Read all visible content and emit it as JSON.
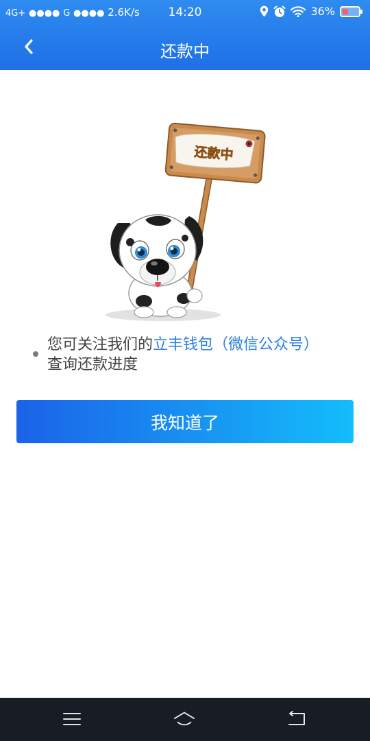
{
  "status_bar": {
    "network_1": "4G+",
    "signal_1": "●●●●",
    "network_2": "G",
    "signal_2": "●●●●",
    "speed": "2.6K/s",
    "time": "14:20",
    "battery": "36%",
    "battery_level": 0.36,
    "icons": [
      "location-icon",
      "alarm-icon",
      "wifi-icon",
      "battery-icon"
    ]
  },
  "header": {
    "title": "还款中",
    "back_icon": "chevron-left-icon"
  },
  "illustration": {
    "sign_text": "还款中",
    "description_icon": "dalmatian-mascot"
  },
  "tip": {
    "text_before": "您可关注我们的",
    "link": "立丰钱包（微信公众号）",
    "text_after": "查询还款进度"
  },
  "primary_button": {
    "label": "我知道了"
  },
  "system_nav": {
    "icons": [
      "menu-icon",
      "home-icon",
      "back-icon"
    ]
  },
  "colors": {
    "header_blue": "#1f6fe6",
    "link_blue": "#2d7fe3",
    "button_gradient_start": "#1b62e8",
    "button_gradient_end": "#14bdfb",
    "nav_bar_dark": "#181d25"
  }
}
